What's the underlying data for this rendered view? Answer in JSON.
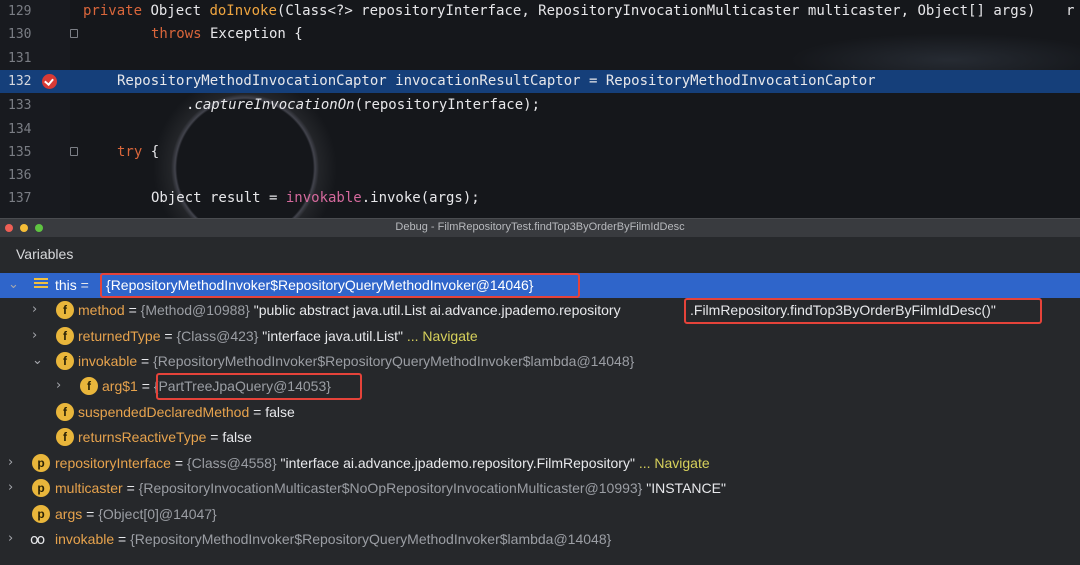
{
  "editor": {
    "lines": [
      {
        "num": "129",
        "tokens": {
          "kw": "private",
          "t1": " Object ",
          "fn": "doInvoke",
          "t2": "(Class<?> repositoryInterface, RepositoryInvocationMulticaster multicaster, Object[] args)",
          "t3": "r"
        }
      },
      {
        "num": "130",
        "tokens": {
          "kw": "throws",
          "t1": " Exception {"
        }
      },
      {
        "num": "131"
      },
      {
        "num": "132",
        "tokens": {
          "t1": "RepositoryMethodInvocationCaptor invocationResultCaptor = RepositoryMethodInvocationCaptor"
        }
      },
      {
        "num": "133",
        "tokens": {
          "t1": ".",
          "it": "captureInvocationOn",
          "t2": "(repositoryInterface);"
        }
      },
      {
        "num": "134"
      },
      {
        "num": "135",
        "tokens": {
          "kw": "try",
          "t1": " {"
        }
      },
      {
        "num": "136"
      },
      {
        "num": "137",
        "tokens": {
          "t1": "Object result = ",
          "fld": "invokable",
          "t2": ".invoke(args);"
        }
      }
    ]
  },
  "debug_window": {
    "title": "Debug - FilmRepositoryTest.findTop3ByOrderByFilmIdDesc"
  },
  "variables_panel": {
    "header": "Variables",
    "rows": [
      {
        "name": "this",
        "eq": " = ",
        "value": "RepositoryMethodInvoker$RepositoryQueryMethodInvoker@14046}"
      },
      {
        "name": "method",
        "eq": " = ",
        "type": "{Method@10988}",
        "value_pre": " \"public abstract java.util.List ai.advance.jpademo.repository",
        "value_boxed": ".FilmRepository.findTop3ByOrderByFilmIdDesc()\""
      },
      {
        "name": "returnedType",
        "eq": " = ",
        "type": "{Class@423}",
        "value": " \"interface java.util.List\"",
        "nav": " ... Navigate"
      },
      {
        "name": "invokable",
        "eq": " = ",
        "type": "{RepositoryMethodInvoker$RepositoryQueryMethodInvoker$lambda@14048}"
      },
      {
        "name": "arg$1",
        "eq": " = ",
        "type": "{PartTreeJpaQuery@14053}"
      },
      {
        "name": "suspendedDeclaredMethod",
        "eq": " = ",
        "value": "false"
      },
      {
        "name": "returnsReactiveType",
        "eq": " = ",
        "value": "false"
      },
      {
        "name": "repositoryInterface",
        "eq": " = ",
        "type": "{Class@4558}",
        "value": " \"interface ai.advance.jpademo.repository.FilmRepository\"",
        "nav": " ... Navigate"
      },
      {
        "name": "multicaster",
        "eq": " = ",
        "type": "{RepositoryInvocationMulticaster$NoOpRepositoryInvocationMulticaster@10993}",
        "value": " \"INSTANCE\""
      },
      {
        "name": "args",
        "eq": " = ",
        "type": "{Object[0]@14047}"
      },
      {
        "name": "invokable",
        "eq": " = ",
        "type": "{RepositoryMethodInvoker$RepositoryQueryMethodInvoker$lambda@14048}"
      }
    ],
    "badges": {
      "field": "f",
      "parameter": "p"
    }
  },
  "colors": {
    "selection": "#2f65ca",
    "highlight_box": "#e5433a",
    "field_badge": "#e9b63b",
    "keyword": "#d9663b"
  }
}
